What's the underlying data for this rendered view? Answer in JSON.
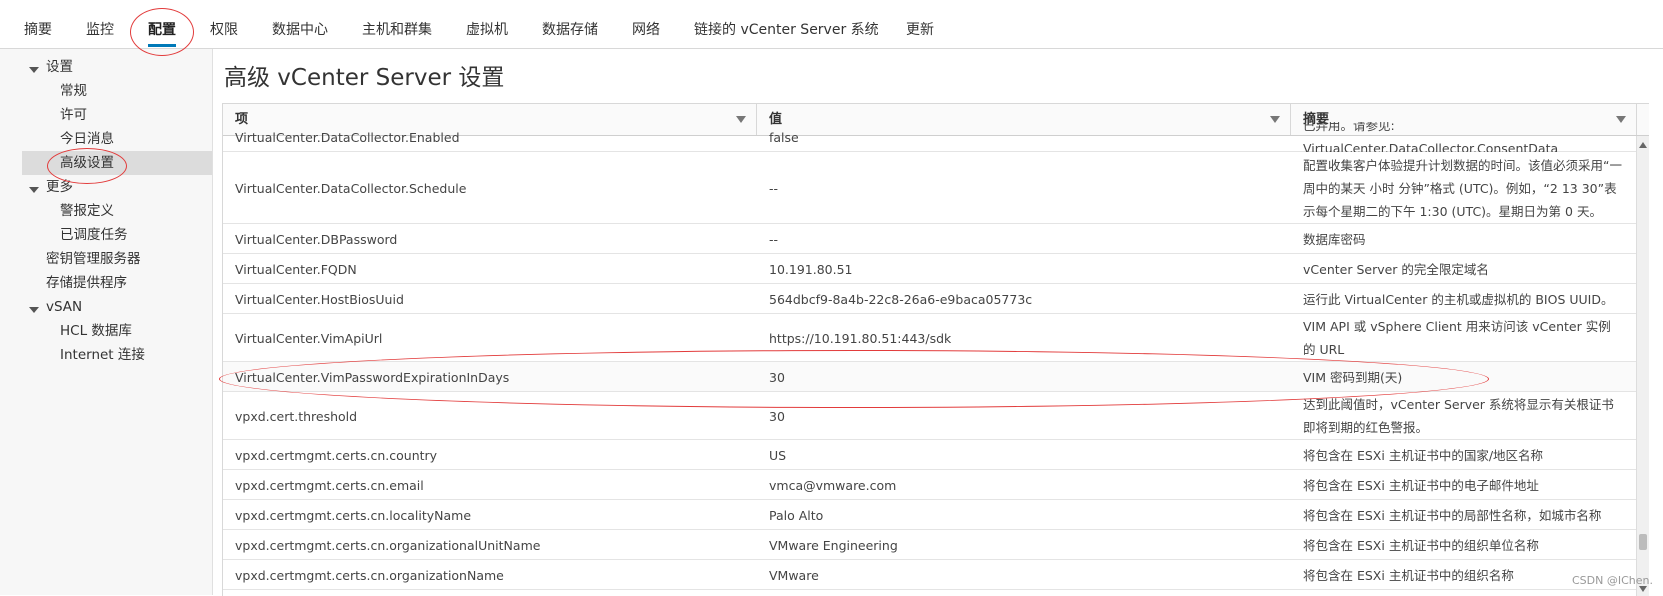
{
  "tabs": [
    "摘要",
    "监控",
    "配置",
    "权限",
    "数据中心",
    "主机和群集",
    "虚拟机",
    "数据存储",
    "网络",
    "链接的 vCenter Server 系统",
    "更新"
  ],
  "active_tab": "配置",
  "nav": {
    "settings": "设置",
    "general": "常规",
    "license": "许可",
    "today_message": "今日消息",
    "advanced": "高级设置",
    "more": "更多",
    "alarm_defs": "警报定义",
    "scheduled_tasks": "已调度任务",
    "key_servers": "密钥管理服务器",
    "storage_providers": "存储提供程序",
    "vsan": "vSAN",
    "hcl_db": "HCL 数据库",
    "internet": "Internet 连接"
  },
  "page_title": "高级 vCenter Server 设置",
  "columns": [
    "项",
    "值",
    "摘要"
  ],
  "rows": [
    {
      "name": "VirtualCenter.DataCollector.Enabled",
      "value": "false",
      "summary": "已弃用。请参见: VirtualCenter.DataCollector.ConsentData"
    },
    {
      "name": "VirtualCenter.DataCollector.Schedule",
      "value": "--",
      "summary": "配置收集客户体验提升计划数据的时间。该值必须采用“一周中的某天 小时 分钟”格式 (UTC)。例如，“2 13 30”表示每个星期二的下午 1:30 (UTC)。星期日为第 0 天。"
    },
    {
      "name": "VirtualCenter.DBPassword",
      "value": "--",
      "summary": "数据库密码"
    },
    {
      "name": "VirtualCenter.FQDN",
      "value": "10.191.80.51",
      "summary": "vCenter Server 的完全限定域名"
    },
    {
      "name": "VirtualCenter.HostBiosUuid",
      "value": "564dbcf9-8a4b-22c8-26a6-e9baca05773c",
      "summary": "运行此 VirtualCenter 的主机或虚拟机的 BIOS UUID。"
    },
    {
      "name": "VirtualCenter.VimApiUrl",
      "value": "https://10.191.80.51:443/sdk",
      "summary": "VIM API 或 vSphere Client 用来访问该 vCenter 实例的 URL"
    },
    {
      "name": "VirtualCenter.VimPasswordExpirationInDays",
      "value": "30",
      "summary": "VIM 密码到期(天)"
    },
    {
      "name": "vpxd.cert.threshold",
      "value": "30",
      "summary": "达到此阈值时，vCenter Server 系统将显示有关根证书即将到期的红色警报。"
    },
    {
      "name": "vpxd.certmgmt.certs.cn.country",
      "value": "US",
      "summary": "将包含在 ESXi 主机证书中的国家/地区名称"
    },
    {
      "name": "vpxd.certmgmt.certs.cn.email",
      "value": "vmca@vmware.com",
      "summary": "将包含在 ESXi 主机证书中的电子邮件地址"
    },
    {
      "name": "vpxd.certmgmt.certs.cn.localityName",
      "value": "Palo Alto",
      "summary": "将包含在 ESXi 主机证书中的局部性名称，如城市名称"
    },
    {
      "name": "vpxd.certmgmt.certs.cn.organizationalUnitName",
      "value": "VMware Engineering",
      "summary": "将包含在 ESXi 主机证书中的组织单位名称"
    },
    {
      "name": "vpxd.certmgmt.certs.cn.organizationName",
      "value": "VMware",
      "summary": "将包含在 ESXi 主机证书中的组织名称"
    }
  ],
  "watermark": "CSDN @IChen."
}
